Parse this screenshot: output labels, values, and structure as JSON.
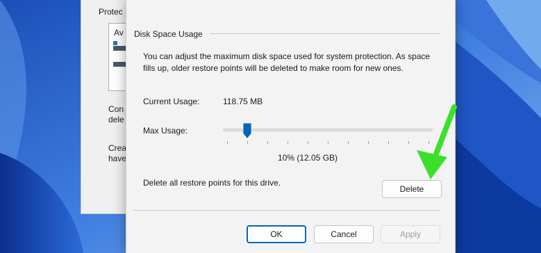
{
  "background_window": {
    "tab_fragment": "Protec",
    "list_item_fragment": "Av",
    "line1_fragment": "Con",
    "line2_fragment": "dele",
    "line3_fragment": "Crea",
    "line4_fragment": "have"
  },
  "dialog": {
    "group_title": "Disk Space Usage",
    "description": "You can adjust the maximum disk space used for system protection. As space fills up, older restore points will be deleted to make room for new ones.",
    "current_usage_label": "Current Usage:",
    "current_usage_value": "118.75 MB",
    "max_usage_label": "Max Usage:",
    "max_usage_percent": 10,
    "max_usage_text": "10% (12.05 GB)",
    "delete_text": "Delete all restore points for this drive.",
    "delete_button": "Delete",
    "ok_button": "OK",
    "cancel_button": "Cancel",
    "apply_button": "Apply"
  },
  "colors": {
    "accent": "#0067c0",
    "arrow": "#3be02a",
    "wallpaper": "#2f64c9"
  }
}
